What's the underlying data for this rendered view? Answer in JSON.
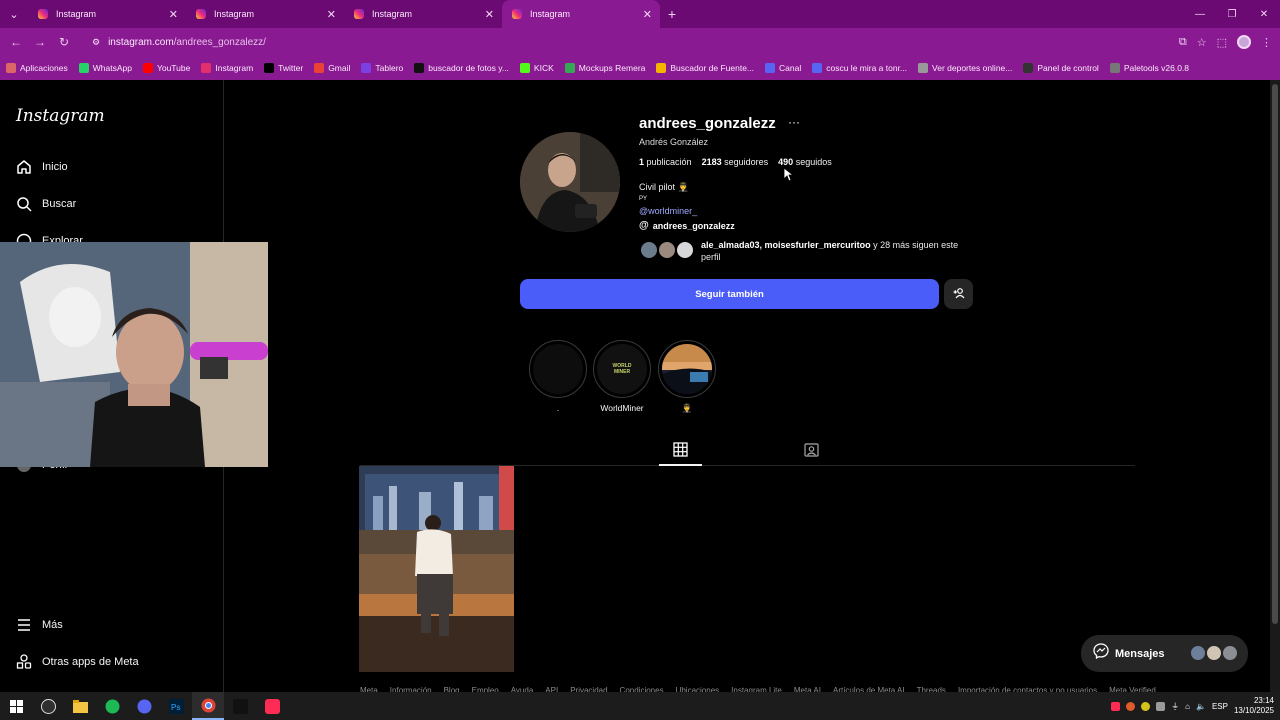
{
  "browser": {
    "tabs": [
      {
        "label": "Instagram",
        "active": false
      },
      {
        "label": "Instagram",
        "active": false
      },
      {
        "label": "Instagram",
        "active": false
      },
      {
        "label": "Instagram",
        "active": true
      }
    ],
    "url_host": "instagram.com",
    "url_path": "/andrees_gonzalezz/",
    "bookmarks": [
      {
        "label": "Aplicaciones",
        "icon": "apps-grid-icon",
        "color": "#d66"
      },
      {
        "label": "WhatsApp",
        "icon": "whatsapp-icon",
        "color": "#25d366"
      },
      {
        "label": "YouTube",
        "icon": "youtube-icon",
        "color": "#ff0000"
      },
      {
        "label": "Instagram",
        "icon": "instagram-icon",
        "color": "#e1306c"
      },
      {
        "label": "Twitter",
        "icon": "x-icon",
        "color": "#000000"
      },
      {
        "label": "Gmail",
        "icon": "gmail-icon",
        "color": "#ea4335"
      },
      {
        "label": "Tablero",
        "icon": "tablero-icon",
        "color": "#7b3fe4"
      },
      {
        "label": "buscador de fotos y...",
        "icon": "p-icon",
        "color": "#111111"
      },
      {
        "label": "KICK",
        "icon": "kick-icon",
        "color": "#53fc18"
      },
      {
        "label": "Mockups Remera",
        "icon": "drive-icon",
        "color": "#34a853"
      },
      {
        "label": "Buscador de Fuente...",
        "icon": "bookmark-icon",
        "color": "#f4b400"
      },
      {
        "label": "Canal",
        "icon": "canal-icon",
        "color": "#5865f2"
      },
      {
        "label": "coscu le mira a tonr...",
        "icon": "chat-icon",
        "color": "#5865f2"
      },
      {
        "label": "Ver deportes online...",
        "icon": "globe-icon",
        "color": "#999999"
      },
      {
        "label": "Panel de control",
        "icon": "panel-icon",
        "color": "#333333"
      },
      {
        "label": "Paletools v26.0.8",
        "icon": "paletools-icon",
        "color": "#777777"
      }
    ]
  },
  "sidebar": {
    "logo": "Instagram",
    "items": [
      {
        "label": "Inicio",
        "icon": "home-icon"
      },
      {
        "label": "Buscar",
        "icon": "search-icon"
      },
      {
        "label": "Explorar",
        "icon": "compass-icon"
      },
      {
        "label": "Perfil",
        "icon": "profile-icon"
      }
    ],
    "bottom": [
      {
        "label": "Más",
        "icon": "menu-icon"
      },
      {
        "label": "Otras apps de Meta",
        "icon": "meta-apps-icon"
      }
    ]
  },
  "profile": {
    "username": "andrees_gonzalezz",
    "full_name": "Andrés González",
    "posts_count": "1",
    "posts_label": "publicación",
    "followers_count": "2183",
    "followers_label": "seguidores",
    "following_count": "490",
    "following_label": "seguidos",
    "bio_line1": "Civil pilot 👨‍✈️",
    "bio_line2": "PY",
    "bio_link": "@worldminer_",
    "threads_handle": "andrees_gonzalezz",
    "followed_by_names": "ale_almada03, moisesfurler_mercuritoo",
    "followed_by_rest": " y 28 más siguen este perfil",
    "follow_button": "Seguir también"
  },
  "highlights": [
    {
      "label": "."
    },
    {
      "label": "WorldMiner",
      "inner_text": "WORLD MINER"
    },
    {
      "label": "👨‍✈️"
    }
  ],
  "footer_links": [
    "Meta",
    "Información",
    "Blog",
    "Empleo",
    "Ayuda",
    "API",
    "Privacidad",
    "Condiciones",
    "Ubicaciones",
    "Instagram Lite",
    "Meta AI",
    "Artículos de Meta AI",
    "Threads",
    "Importación de contactos y no usuarios",
    "Meta Verified"
  ],
  "messages": {
    "label": "Mensajes"
  },
  "taskbar": {
    "lang": "ESP",
    "time": "23:14",
    "date": "13/10/2025"
  },
  "colors": {
    "chrome_frame": "#6b0a73",
    "chrome_toolbar": "#8a1a92",
    "follow_button": "#4a5df9",
    "link": "#a0a9ff"
  }
}
